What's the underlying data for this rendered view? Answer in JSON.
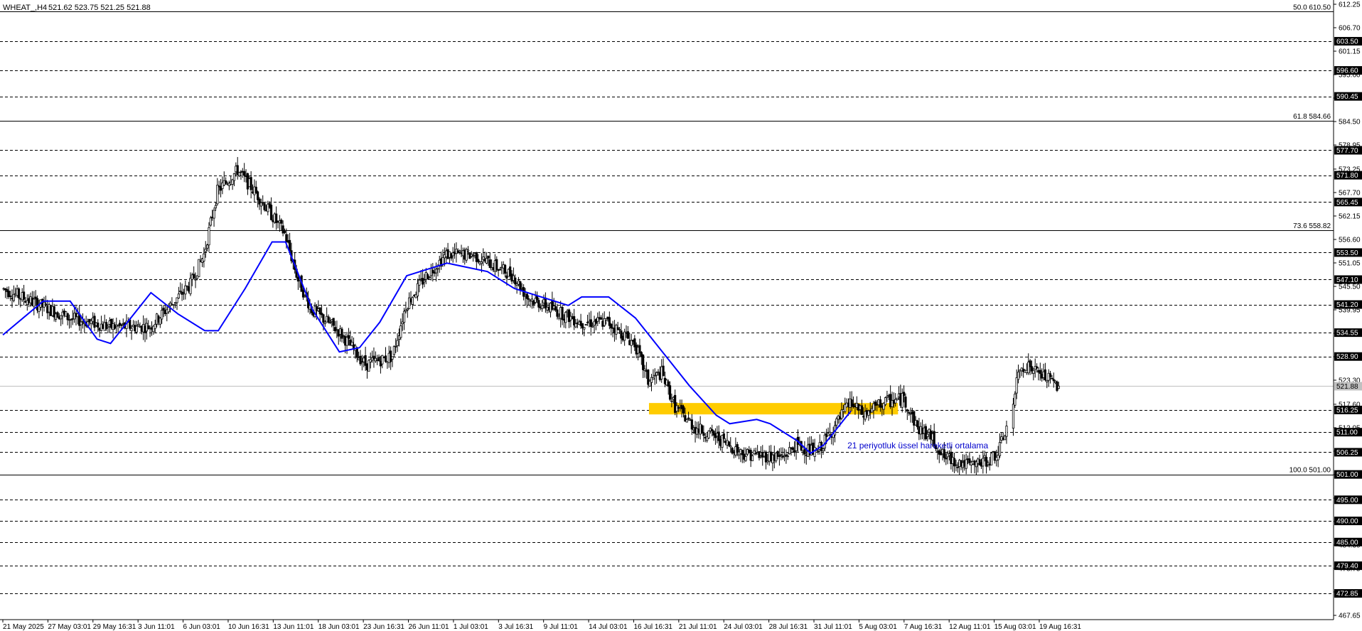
{
  "header": {
    "symbol": "WHEAT_,H4",
    "ohlc": "521.62 523.75 521.25 521.88"
  },
  "chart_data": {
    "type": "candlestick",
    "ylim": [
      467.65,
      612.25
    ],
    "current_price": 521.88,
    "price_axis_ticks": [
      612.25,
      606.7,
      601.15,
      595.6,
      590.05,
      584.5,
      578.95,
      573.25,
      567.7,
      562.15,
      556.6,
      551.05,
      545.5,
      539.95,
      534.4,
      528.85,
      523.3,
      517.6,
      512.05,
      506.5,
      500.95,
      495.4,
      489.85,
      484.3,
      478.75,
      473.2,
      467.65
    ],
    "levels": [
      610.5,
      603.5,
      596.6,
      590.45,
      584.66,
      577.7,
      571.8,
      565.45,
      558.82,
      553.5,
      547.1,
      541.2,
      534.55,
      528.9,
      516.25,
      511.0,
      506.25,
      501.0,
      495.0,
      490.0,
      485.0,
      479.4,
      472.85
    ],
    "fibonacci": [
      {
        "label": "50.0 610.50",
        "value": 610.5
      },
      {
        "label": "61.8 584.66",
        "value": 584.66
      },
      {
        "label": "73.6 558.82",
        "value": 558.82
      },
      {
        "label": "100.0 501.00",
        "value": 501.0
      }
    ],
    "time_labels": [
      "21 May 2025",
      "27 May 03:01",
      "29 May 16:31",
      "3 Jun 11:01",
      "6 Jun 03:01",
      "10 Jun 16:31",
      "13 Jun 11:01",
      "18 Jun 03:01",
      "23 Jun 16:31",
      "26 Jun 11:01",
      "1 Jul 03:01",
      "3 Jul 16:31",
      "9 Jul 11:01",
      "14 Jul 03:01",
      "16 Jul 16:31",
      "21 Jul 11:01",
      "24 Jul 03:01",
      "28 Jul 16:31",
      "31 Jul 11:01",
      "5 Aug 03:01",
      "7 Aug 16:31",
      "12 Aug 11:01",
      "15 Aug 03:01",
      "19 Aug 16:31"
    ],
    "price_path": [
      [
        0,
        545
      ],
      [
        10,
        538
      ],
      [
        16,
        536
      ],
      [
        22,
        536
      ],
      [
        28,
        546
      ],
      [
        30,
        553
      ],
      [
        32,
        568
      ],
      [
        35,
        573
      ],
      [
        38,
        567
      ],
      [
        42,
        558
      ],
      [
        44,
        547
      ],
      [
        46,
        540
      ],
      [
        50,
        535
      ],
      [
        54,
        527
      ],
      [
        58,
        529
      ],
      [
        60,
        541
      ],
      [
        63,
        548
      ],
      [
        66,
        553
      ],
      [
        70,
        553
      ],
      [
        76,
        548
      ],
      [
        78,
        543
      ],
      [
        82,
        540
      ],
      [
        86,
        537
      ],
      [
        90,
        537
      ],
      [
        94,
        532
      ],
      [
        96,
        523
      ],
      [
        98,
        525
      ],
      [
        100,
        517
      ],
      [
        103,
        512
      ],
      [
        106,
        510
      ],
      [
        110,
        506
      ],
      [
        116,
        505
      ],
      [
        118,
        508
      ],
      [
        121,
        506
      ],
      [
        124,
        513
      ],
      [
        126,
        518
      ],
      [
        128,
        515
      ],
      [
        131,
        518
      ],
      [
        134,
        519
      ],
      [
        136,
        512
      ],
      [
        138,
        510
      ],
      [
        140,
        505
      ],
      [
        144,
        503
      ],
      [
        146,
        504
      ],
      [
        148,
        506
      ],
      [
        149,
        511
      ],
      [
        150,
        515
      ],
      [
        151,
        525
      ],
      [
        152,
        527
      ],
      [
        154,
        525
      ],
      [
        157,
        521.88
      ]
    ],
    "gap_after_index": 149,
    "ema": {
      "name": "21 periyotluk üssel hareketli ortalama",
      "color": "#0000ff",
      "points": [
        [
          0,
          534
        ],
        [
          6,
          542
        ],
        [
          10,
          542
        ],
        [
          14,
          533
        ],
        [
          16,
          532
        ],
        [
          22,
          544
        ],
        [
          26,
          539
        ],
        [
          30,
          535
        ],
        [
          32,
          535
        ],
        [
          36,
          545
        ],
        [
          40,
          556
        ],
        [
          42,
          556
        ],
        [
          46,
          540
        ],
        [
          50,
          530
        ],
        [
          53,
          531
        ],
        [
          56,
          537
        ],
        [
          60,
          548
        ],
        [
          64,
          550
        ],
        [
          66,
          551
        ],
        [
          72,
          549
        ],
        [
          76,
          545
        ],
        [
          80,
          543
        ],
        [
          84,
          541
        ],
        [
          86,
          543
        ],
        [
          90,
          543
        ],
        [
          94,
          538
        ],
        [
          98,
          530
        ],
        [
          102,
          522
        ],
        [
          106,
          515
        ],
        [
          108,
          513
        ],
        [
          112,
          514
        ],
        [
          114,
          513
        ],
        [
          118,
          509
        ],
        [
          120,
          506
        ],
        [
          122,
          508
        ],
        [
          126,
          516
        ]
      ]
    },
    "highlight_zone": {
      "x_from": 96,
      "x_to": 133,
      "low": 515.2,
      "high": 517.9,
      "color": "#ffcc00"
    },
    "annotation": {
      "text": "21 periyotluk üssel hareketli ortalama",
      "color": "#0000cc",
      "x": 124,
      "price": 507.8
    },
    "colors": {
      "candle": "#000000",
      "level": "#000000",
      "current_price_line": "#c0c0c0",
      "background": "#ffffff"
    }
  }
}
